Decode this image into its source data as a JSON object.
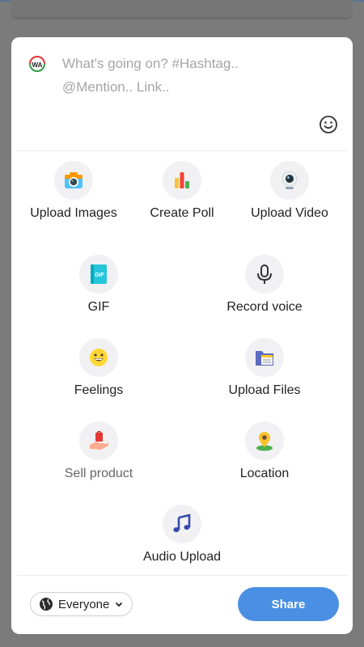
{
  "composer": {
    "placeholder_line1": "What's going on? #Hashtag..",
    "placeholder_line2": "@Mention.. Link..",
    "logo_text": "WA"
  },
  "options": [
    {
      "label": "Upload Images",
      "icon": "camera-icon"
    },
    {
      "label": "Create Poll",
      "icon": "bar-chart-icon"
    },
    {
      "label": "Upload Video",
      "icon": "webcam-icon"
    },
    {
      "label": "GIF",
      "icon": "gif-icon"
    },
    {
      "label": "Record voice",
      "icon": "microphone-icon"
    },
    {
      "label": "Feelings",
      "icon": "smiley-icon"
    },
    {
      "label": "Upload Files",
      "icon": "folder-icon"
    },
    {
      "label": "Sell product",
      "icon": "shopping-bag-hand-icon"
    },
    {
      "label": "Location",
      "icon": "map-pin-icon"
    },
    {
      "label": "Audio Upload",
      "icon": "music-note-icon"
    }
  ],
  "footer": {
    "audience_label": "Everyone",
    "share_label": "Share"
  },
  "colors": {
    "accent": "#4a8fe3",
    "overlay": "#7b7b7b"
  }
}
